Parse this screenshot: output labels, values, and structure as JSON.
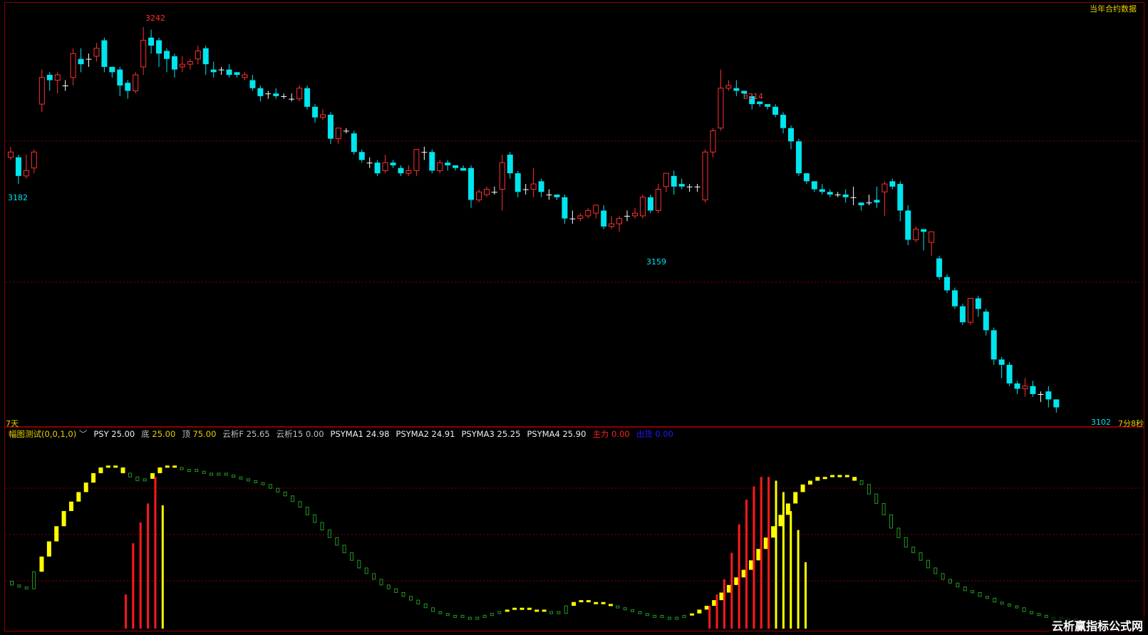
{
  "header": {
    "contract_label": "当年合约数据"
  },
  "main_chart": {
    "period_label": "7天",
    "countdown_label": "7分8秒",
    "high_mark": "3242",
    "low_mark_left": "3182",
    "high_mark_mid": "3214",
    "low_mark_mid": "3159",
    "last_mark": "3102",
    "colors": {
      "up": "#ff3030",
      "down": "#00e5ee",
      "grid": "#8b0000",
      "bg": "#000000"
    }
  },
  "indicator": {
    "name": "幅图测试(0,0,1,0)",
    "psy_label": "PSY",
    "psy_value": "25.00",
    "di_label": "底",
    "di_value": "25.00",
    "ding_label": "顶",
    "ding_value": "75.00",
    "yxf_label": "云析F",
    "yxf_value": "25.65",
    "yx15_label": "云析15",
    "yx15_value": "0.00",
    "ma1_label": "PSYMA1",
    "ma1_value": "24.98",
    "ma2_label": "PSYMA2",
    "ma2_value": "24.91",
    "ma3_label": "PSYMA3",
    "ma3_value": "25.25",
    "ma4_label": "PSYMA4",
    "ma4_value": "25.90",
    "zhuli_label": "主力",
    "zhuli_value": "0.00",
    "chuhuo_label": "出货",
    "chuhuo_value": "0.00"
  },
  "watermark": "云析赢指标公式网",
  "chart_data": [
    {
      "type": "candlestick",
      "ylim": [
        3095,
        3252
      ],
      "candles": [
        [
          3195,
          3197,
          3194,
          3199
        ],
        [
          3195,
          3188,
          3185,
          3196
        ],
        [
          3188,
          3190,
          3187,
          3196
        ],
        [
          3191,
          3197,
          3189,
          3198
        ],
        [
          3215,
          3225,
          3212,
          3228
        ],
        [
          3226,
          3224,
          3220,
          3227
        ],
        [
          3224,
          3226,
          3219,
          3227
        ],
        [
          3222,
          3222,
          3220,
          3224
        ],
        [
          3225,
          3234,
          3222,
          3236
        ],
        [
          3232,
          3230,
          3227,
          3236
        ],
        [
          3232,
          3232,
          3229,
          3234
        ],
        [
          3233,
          3236,
          3231,
          3238
        ],
        [
          3239,
          3229,
          3227,
          3240
        ],
        [
          3229,
          3227,
          3225,
          3229
        ],
        [
          3228,
          3222,
          3218,
          3229
        ],
        [
          3223,
          3220,
          3217,
          3224
        ],
        [
          3220,
          3226,
          3219,
          3227
        ],
        [
          3229,
          3239,
          3226,
          3244
        ],
        [
          3240,
          3237,
          3234,
          3243
        ],
        [
          3239,
          3234,
          3229,
          3240
        ],
        [
          3235,
          3232,
          3227,
          3236
        ],
        [
          3233,
          3228,
          3225,
          3234
        ],
        [
          3229,
          3230,
          3227,
          3233
        ],
        [
          3230,
          3231,
          3228,
          3232
        ],
        [
          3232,
          3235,
          3230,
          3237
        ],
        [
          3236,
          3230,
          3226,
          3237
        ],
        [
          3228,
          3227,
          3225,
          3231
        ],
        [
          3228,
          3228,
          3226,
          3229
        ],
        [
          3228,
          3226,
          3225,
          3230
        ],
        [
          3227,
          3226,
          3225,
          3227
        ],
        [
          3225,
          3226,
          3224,
          3227
        ],
        [
          3224,
          3221,
          3220,
          3226
        ],
        [
          3221,
          3218,
          3216,
          3222
        ],
        [
          3219,
          3219,
          3217,
          3220
        ],
        [
          3219,
          3218,
          3217,
          3221
        ],
        [
          3218,
          3218,
          3217,
          3219
        ],
        [
          3217,
          3217,
          3216,
          3219
        ],
        [
          3217,
          3221,
          3216,
          3222
        ],
        [
          3221,
          3214,
          3213,
          3222
        ],
        [
          3214,
          3210,
          3208,
          3215
        ],
        [
          3210,
          3211,
          3209,
          3213
        ],
        [
          3211,
          3202,
          3200,
          3212
        ],
        [
          3202,
          3206,
          3200,
          3206
        ],
        [
          3205,
          3205,
          3204,
          3206
        ],
        [
          3204,
          3197,
          3196,
          3205
        ],
        [
          3197,
          3194,
          3193,
          3198
        ],
        [
          3193,
          3193,
          3191,
          3195
        ],
        [
          3193,
          3189,
          3188,
          3194
        ],
        [
          3190,
          3193,
          3189,
          3196
        ],
        [
          3193,
          3192,
          3191,
          3194
        ],
        [
          3191,
          3189,
          3188,
          3192
        ],
        [
          3189,
          3190,
          3188,
          3192
        ],
        [
          3190,
          3198,
          3188,
          3198
        ],
        [
          3197,
          3197,
          3194,
          3199
        ],
        [
          3197,
          3190,
          3189,
          3198
        ],
        [
          3190,
          3193,
          3189,
          3194
        ],
        [
          3193,
          3192,
          3190,
          3194
        ],
        [
          3192,
          3191,
          3190,
          3192
        ],
        [
          3191,
          3190,
          3190,
          3192
        ],
        [
          3191,
          3179,
          3176,
          3192
        ],
        [
          3179,
          3182,
          3178,
          3183
        ],
        [
          3181,
          3183,
          3180,
          3184
        ],
        [
          3182,
          3182,
          3181,
          3184
        ],
        [
          3183,
          3193,
          3175,
          3196
        ],
        [
          3196,
          3189,
          3187,
          3197
        ],
        [
          3189,
          3182,
          3180,
          3190
        ],
        [
          3183,
          3183,
          3181,
          3185
        ],
        [
          3183,
          3185,
          3180,
          3191
        ],
        [
          3186,
          3182,
          3180,
          3187
        ],
        [
          3181,
          3181,
          3179,
          3183
        ],
        [
          3181,
          3180,
          3179,
          3181
        ],
        [
          3180,
          3172,
          3170,
          3181
        ],
        [
          3172,
          3172,
          3170,
          3175
        ],
        [
          3172,
          3173,
          3171,
          3174
        ],
        [
          3173,
          3175,
          3172,
          3176
        ],
        [
          3174,
          3177,
          3172,
          3177
        ],
        [
          3175,
          3169,
          3168,
          3177
        ],
        [
          3169,
          3170,
          3168,
          3173
        ],
        [
          3170,
          3172,
          3167,
          3173
        ],
        [
          3173,
          3173,
          3171,
          3175
        ],
        [
          3173,
          3174,
          3172,
          3176
        ],
        [
          3173,
          3180,
          3172,
          3181
        ],
        [
          3180,
          3175,
          3174,
          3181
        ],
        [
          3175,
          3183,
          3174,
          3185
        ],
        [
          3184,
          3189,
          3182,
          3189
        ],
        [
          3188,
          3184,
          3181,
          3190
        ],
        [
          3185,
          3184,
          3183,
          3187
        ],
        [
          3184,
          3184,
          3182,
          3185
        ],
        [
          3184,
          3184,
          3182,
          3185
        ],
        [
          3179,
          3197,
          3178,
          3198
        ],
        [
          3197,
          3205,
          3195,
          3206
        ],
        [
          3206,
          3221,
          3205,
          3228
        ],
        [
          3221,
          3222,
          3220,
          3224
        ],
        [
          3221,
          3220,
          3218,
          3224
        ],
        [
          3220,
          3219,
          3217,
          3220
        ],
        [
          3218,
          3215,
          3213,
          3219
        ],
        [
          3216,
          3215,
          3214,
          3216
        ],
        [
          3215,
          3214,
          3213,
          3215
        ],
        [
          3214,
          3211,
          3210,
          3215
        ],
        [
          3211,
          3206,
          3204,
          3212
        ],
        [
          3206,
          3201,
          3198,
          3207
        ],
        [
          3201,
          3189,
          3188,
          3202
        ],
        [
          3189,
          3186,
          3185,
          3189
        ],
        [
          3186,
          3183,
          3182,
          3186
        ],
        [
          3183,
          3182,
          3181,
          3185
        ],
        [
          3182,
          3181,
          3180,
          3183
        ],
        [
          3181,
          3181,
          3180,
          3182
        ],
        [
          3181,
          3180,
          3178,
          3183
        ],
        [
          3180,
          3180,
          3177,
          3184
        ],
        [
          3178,
          3177,
          3175,
          3178
        ],
        [
          3178,
          3178,
          3177,
          3181
        ],
        [
          3179,
          3178,
          3176,
          3184
        ],
        [
          3182,
          3185,
          3173,
          3186
        ],
        [
          3186,
          3184,
          3183,
          3187
        ],
        [
          3185,
          3175,
          3171,
          3186
        ],
        [
          3175,
          3164,
          3162,
          3177
        ],
        [
          3164,
          3168,
          3163,
          3169
        ],
        [
          3168,
          3167,
          3160,
          3168
        ],
        [
          3163,
          3167,
          3158,
          3167
        ],
        [
          3157,
          3150,
          3149,
          3158
        ],
        [
          3150,
          3145,
          3144,
          3151
        ],
        [
          3145,
          3139,
          3138,
          3146
        ],
        [
          3139,
          3133,
          3132,
          3140
        ],
        [
          3133,
          3142,
          3132,
          3142
        ],
        [
          3142,
          3138,
          3135,
          3143
        ],
        [
          3137,
          3130,
          3128,
          3138
        ],
        [
          3130,
          3119,
          3117,
          3131
        ],
        [
          3119,
          3117,
          3112,
          3120
        ],
        [
          3117,
          3110,
          3109,
          3118
        ],
        [
          3110,
          3108,
          3106,
          3111
        ],
        [
          3108,
          3109,
          3105,
          3112
        ],
        [
          3109,
          3106,
          3105,
          3111
        ],
        [
          3106,
          3106,
          3103,
          3107
        ],
        [
          3107,
          3104,
          3101,
          3109
        ],
        [
          3104,
          3101,
          3099,
          3104
        ]
      ]
    },
    {
      "type": "bar",
      "ylim": [
        0,
        100
      ],
      "psy": [
        25,
        23,
        22,
        21,
        30,
        38,
        46,
        54,
        62,
        67,
        72,
        77,
        82,
        85,
        86,
        85,
        82,
        80,
        78,
        79,
        82,
        85,
        86,
        85,
        84,
        84,
        83,
        82,
        82,
        82,
        81,
        80,
        79,
        78,
        77,
        76,
        74,
        72,
        70,
        67,
        64,
        60,
        56,
        52,
        48,
        44,
        40,
        36,
        32,
        29,
        26,
        23,
        21,
        19,
        17,
        15,
        13,
        11,
        9,
        8,
        7,
        7,
        6,
        6,
        6,
        7,
        8,
        9,
        10,
        11,
        11,
        10,
        10,
        9,
        9,
        8,
        12,
        14,
        15,
        14,
        14,
        13,
        12,
        11,
        10,
        9,
        8,
        7,
        7,
        6,
        6,
        6,
        7,
        8,
        10,
        12,
        15,
        19,
        23,
        27,
        31,
        36,
        42,
        48,
        54,
        60,
        66,
        72,
        76,
        78,
        80,
        80,
        81,
        81,
        80,
        78,
        76,
        71,
        66,
        60,
        53,
        48,
        43,
        40,
        36,
        32,
        29,
        26,
        24,
        22,
        20,
        19,
        17,
        16,
        14,
        13,
        12,
        11,
        9,
        8,
        7,
        6,
        6,
        5,
        5,
        4,
        4,
        3,
        3,
        3,
        2,
        2
      ],
      "state": [
        "g",
        "g",
        "g",
        "g",
        "y",
        "y",
        "y",
        "y",
        "y",
        "y",
        "y",
        "y",
        "y",
        "y",
        "y",
        "y",
        "g",
        "g",
        "g",
        "y",
        "y",
        "y",
        "y",
        "g",
        "g",
        "g",
        "g",
        "g",
        "g",
        "g",
        "g",
        "g",
        "g",
        "g",
        "g",
        "g",
        "g",
        "g",
        "g",
        "g",
        "g",
        "g",
        "g",
        "g",
        "g",
        "g",
        "g",
        "g",
        "g",
        "g",
        "g",
        "g",
        "g",
        "g",
        "g",
        "g",
        "g",
        "g",
        "g",
        "g",
        "g",
        "g",
        "g",
        "g",
        "g",
        "g",
        "g",
        "y",
        "y",
        "y",
        "y",
        "y",
        "y",
        "g",
        "g",
        "g",
        "y",
        "y",
        "y",
        "y",
        "y",
        "y",
        "g",
        "g",
        "g",
        "g",
        "g",
        "g",
        "g",
        "g",
        "g",
        "g",
        "y",
        "y",
        "y",
        "y",
        "y",
        "y",
        "y",
        "y",
        "y",
        "y",
        "y",
        "y",
        "y",
        "y",
        "y",
        "y",
        "y",
        "y",
        "y",
        "y",
        "y",
        "y",
        "y",
        "g",
        "g",
        "g",
        "g",
        "g",
        "g",
        "g",
        "g",
        "g",
        "g",
        "g",
        "g",
        "g",
        "g",
        "g",
        "g",
        "g",
        "g",
        "g",
        "g",
        "g",
        "g",
        "g",
        "g",
        "g",
        "g",
        "g",
        "g",
        "g",
        "g",
        "g",
        "g",
        "g",
        "g",
        "g",
        "g",
        "g"
      ],
      "zhuli": [
        [
          8,
          "r",
          18
        ],
        [
          9,
          "r",
          45
        ],
        [
          10,
          "r",
          56
        ],
        [
          11,
          "r",
          66
        ],
        [
          12,
          "r",
          80
        ],
        [
          13,
          "y",
          65
        ],
        [
          87,
          "r",
          12
        ],
        [
          88,
          "r",
          18
        ],
        [
          89,
          "r",
          26
        ],
        [
          90,
          "r",
          40
        ],
        [
          91,
          "r",
          55
        ],
        [
          92,
          "r",
          68
        ],
        [
          93,
          "r",
          75
        ],
        [
          94,
          "r",
          80
        ],
        [
          95,
          "r",
          80
        ],
        [
          96,
          "y",
          78
        ],
        [
          97,
          "y",
          72
        ],
        [
          98,
          "y",
          62
        ],
        [
          99,
          "y",
          52
        ],
        [
          100,
          "y",
          35
        ]
      ]
    }
  ]
}
